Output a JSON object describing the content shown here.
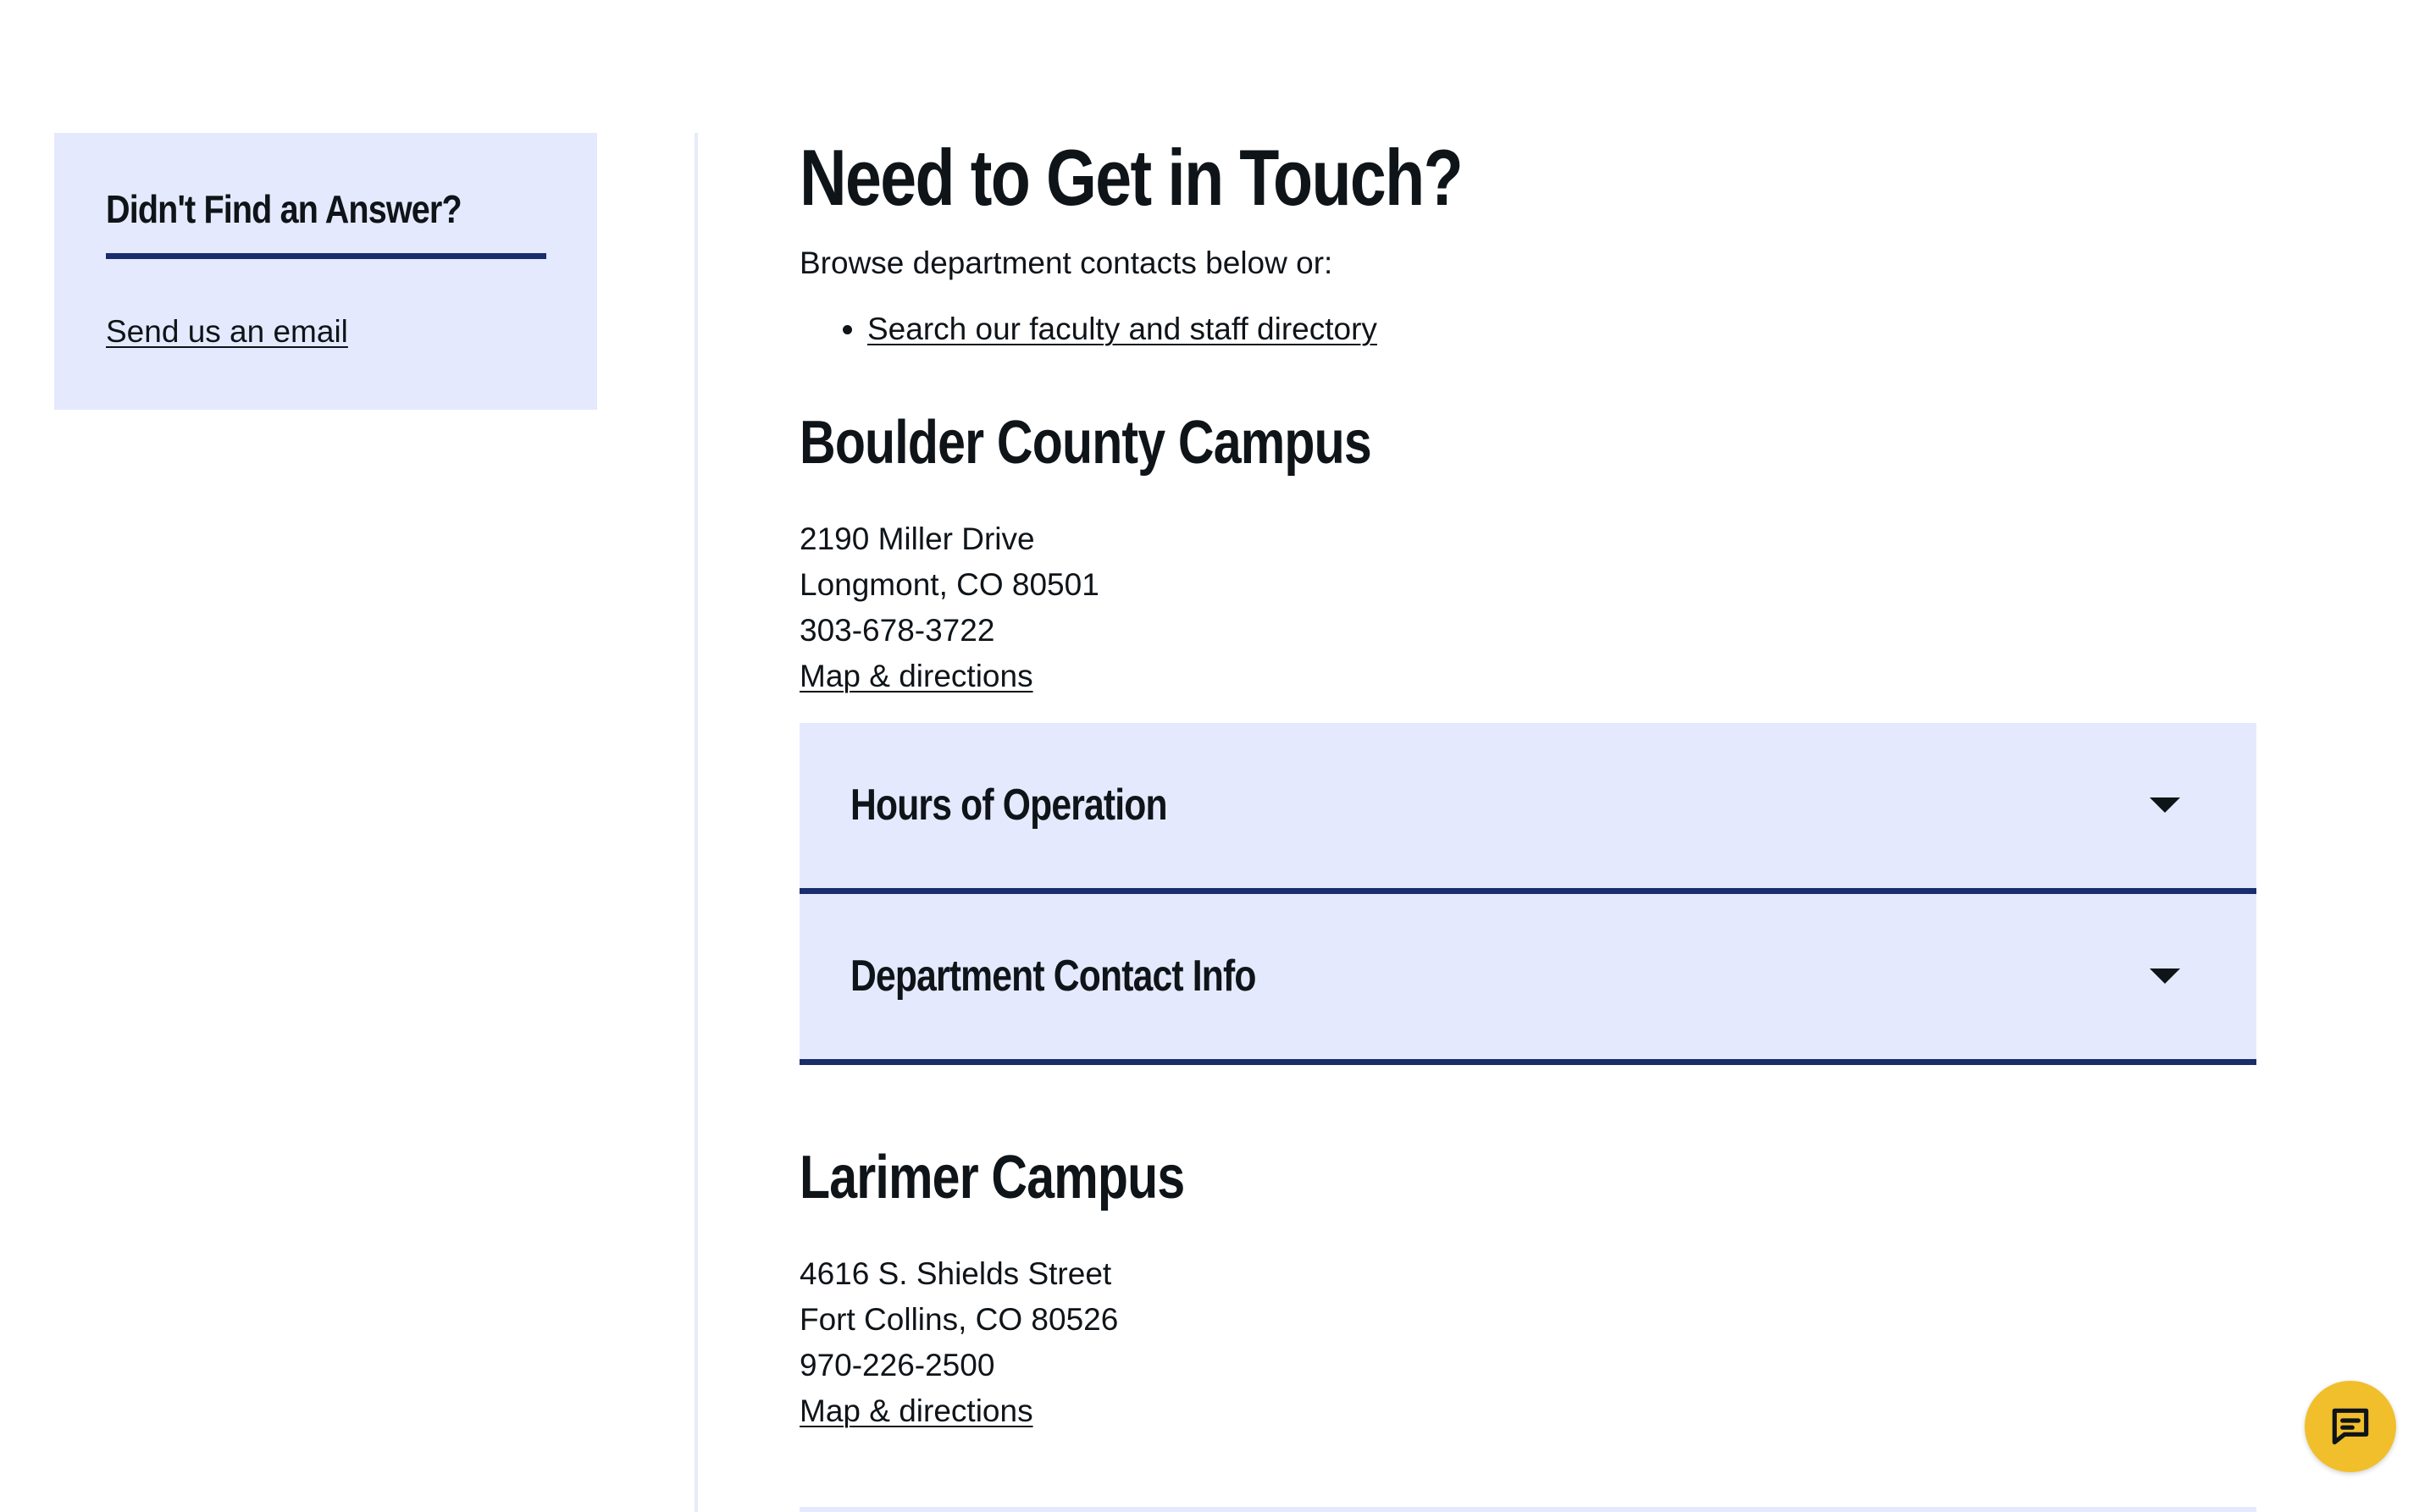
{
  "sidebar": {
    "title": "Didn't Find an Answer?",
    "link": "Send us an email"
  },
  "main": {
    "heading": "Need to Get in Touch?",
    "intro": "Browse department contacts below or:",
    "bullets": [
      "Search our faculty and staff directory"
    ]
  },
  "campuses": [
    {
      "name": "Boulder County Campus",
      "address1": "2190 Miller Drive",
      "address2": "Longmont, CO 80501",
      "phone": "303-678-3722",
      "map_link": "Map & directions",
      "accordion": [
        {
          "label": "Hours of Operation",
          "expanded": false
        },
        {
          "label": "Department Contact Info",
          "expanded": false
        }
      ]
    },
    {
      "name": "Larimer Campus",
      "address1": "4616 S. Shields Street",
      "address2": "Fort Collins, CO 80526",
      "phone": "970-226-2500",
      "map_link": "Map & directions"
    }
  ],
  "chat": {
    "icon": "chat-bubble-icon"
  },
  "colors": {
    "card_bg": "#e5e9fd",
    "accent_navy": "#1a2d6b",
    "chat_yellow": "#f1bf2b",
    "text": "#0f1419"
  }
}
